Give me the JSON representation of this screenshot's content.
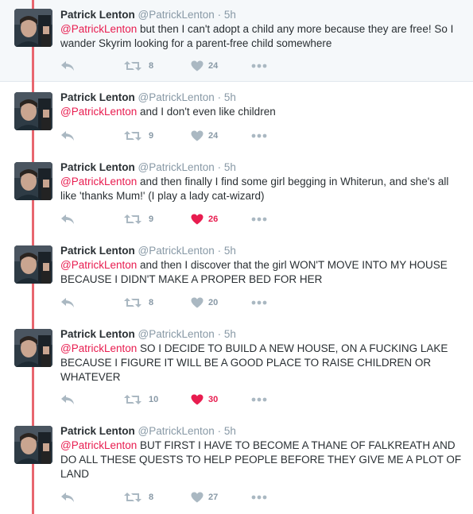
{
  "colors": {
    "mention": "#e81c4f",
    "thread_line": "#e8666f",
    "muted": "#8899a6",
    "liked": "#e81c4f"
  },
  "icons": {
    "reply": "reply-icon",
    "retweet": "retweet-icon",
    "like": "heart-icon",
    "more": "more-dots-icon"
  },
  "tweets": [
    {
      "name": "Patrick Lenton",
      "handle": "@PatrickLenton",
      "dot": "·",
      "time": "5h",
      "mention": "@PatrickLenton",
      "text": " but then I can't adopt a child any more because they are free! So I wander Skyrim looking for a parent-free child somewhere",
      "retweets": "8",
      "likes": "24",
      "liked": false
    },
    {
      "name": "Patrick Lenton",
      "handle": "@PatrickLenton",
      "dot": "·",
      "time": "5h",
      "mention": "@PatrickLenton",
      "text": " and I don't even like children",
      "retweets": "9",
      "likes": "24",
      "liked": false
    },
    {
      "name": "Patrick Lenton",
      "handle": "@PatrickLenton",
      "dot": "·",
      "time": "5h",
      "mention": "@PatrickLenton",
      "text": " and then finally I find some girl begging in Whiterun, and she's all like 'thanks Mum!' (I play a lady cat-wizard)",
      "retweets": "9",
      "likes": "26",
      "liked": true
    },
    {
      "name": "Patrick Lenton",
      "handle": "@PatrickLenton",
      "dot": "·",
      "time": "5h",
      "mention": "@PatrickLenton",
      "text": " and then I discover that the girl WON'T MOVE INTO MY HOUSE BECAUSE I DIDN'T MAKE A PROPER BED FOR HER",
      "retweets": "8",
      "likes": "20",
      "liked": false
    },
    {
      "name": "Patrick Lenton",
      "handle": "@PatrickLenton",
      "dot": "·",
      "time": "5h",
      "mention": "@PatrickLenton",
      "text": " SO I DECIDE TO BUILD A NEW HOUSE, ON A FUCKING LAKE BECAUSE I FIGURE IT WILL BE A GOOD PLACE TO RAISE CHILDREN OR WHATEVER",
      "retweets": "10",
      "likes": "30",
      "liked": true
    },
    {
      "name": "Patrick Lenton",
      "handle": "@PatrickLenton",
      "dot": "·",
      "time": "5h",
      "mention": "@PatrickLenton",
      "text": " BUT FIRST I HAVE TO BECOME A THANE OF FALKREATH AND DO ALL THESE QUESTS TO HELP PEOPLE BEFORE THEY GIVE ME A PLOT OF LAND",
      "retweets": "8",
      "likes": "27",
      "liked": false
    }
  ]
}
